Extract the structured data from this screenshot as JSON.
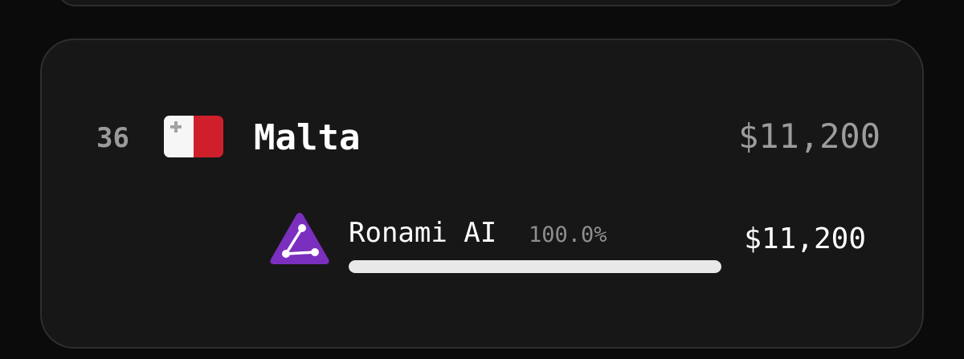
{
  "entry": {
    "rank": "36",
    "country": "Malta",
    "flag_icon": "malta-flag",
    "total": "$11,200",
    "companies": [
      {
        "name": "Ronami AI",
        "share": "100.0%",
        "share_fraction": 1.0,
        "amount": "$11,200",
        "logo_icon": "ronami-ai-logo",
        "logo_color": "#7b2fbe"
      }
    ]
  },
  "colors": {
    "background": "#0b0b0b",
    "card": "#171717",
    "flag_red": "#cf1f2b",
    "flag_white": "#f6f6f6",
    "progress_fill": "#e8e8e8"
  }
}
